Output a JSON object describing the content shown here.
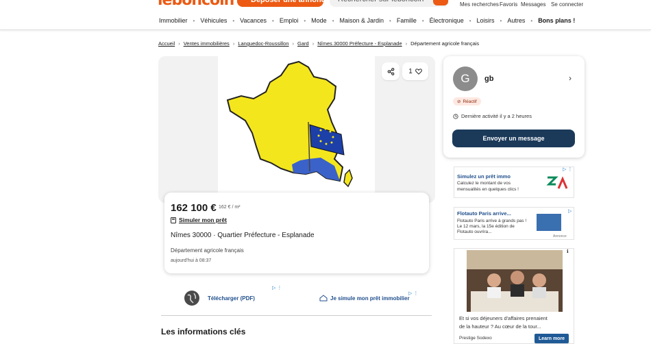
{
  "header": {
    "logo": "leboncoin",
    "post_button": "Déposer une annonce",
    "search_placeholder": "Rechercher sur leboncoin",
    "links": [
      "Mes recherches",
      "Favoris",
      "Messages",
      "Se connecter"
    ],
    "categories": [
      "Immobilier",
      "Véhicules",
      "Vacances",
      "Emploi",
      "Mode",
      "Maison & Jardin",
      "Famille",
      "Électronique",
      "Loisirs",
      "Autres"
    ],
    "bons_plans": "Bons plans !"
  },
  "breadcrumb": {
    "items": [
      "Accueil",
      "Ventes immobilières",
      "Languedoc-Roussillon",
      "Gard",
      "Nîmes 30000 Préfecture - Esplanade"
    ],
    "current": "Département agricole français"
  },
  "gallery": {
    "fav_count": "1"
  },
  "listing": {
    "price": "162 100 €",
    "price_per_m2": "162 € / m²",
    "simulate_loan": "Simuler mon prêt",
    "location": "Nîmes 30000 · Quartier Préfecture - Esplanade",
    "title": "Département agricole français",
    "date": "aujourd'hui à 08:37"
  },
  "ad_row": {
    "download": "Télécharger (PDF)",
    "simulate": "Je simule mon prêt immobilier"
  },
  "section": {
    "title": "Les informations clés"
  },
  "seller": {
    "initial": "G",
    "name": "gb",
    "badge": "Réactif",
    "last_activity": "Dernière activité il y a 2 heures",
    "message_button": "Envoyer un message"
  },
  "ads": {
    "credit": {
      "title": "Simulez un prêt immo",
      "text": [
        "Calculez le montant de vos",
        "mensualités en quelques clics !"
      ]
    },
    "flotauto": {
      "title": "Flotauto Paris arrive...",
      "text": [
        "Flotauto Paris arrive à grands pas !",
        "Le 12 mars, la 15e édition de",
        "Flotauto ouvrira..."
      ],
      "annonce": "Annonce"
    },
    "sodexo": {
      "text": [
        "Et si vos déjeuners d'affaires prenaient",
        "de la hauteur ? Au cœur de la tour..."
      ],
      "sponsor": "Prestige Sodexo",
      "more": "Learn more"
    }
  },
  "colors": {
    "brand": "#ec5a13",
    "primary": "#1b3a5a",
    "link": "#1f4e8c"
  }
}
